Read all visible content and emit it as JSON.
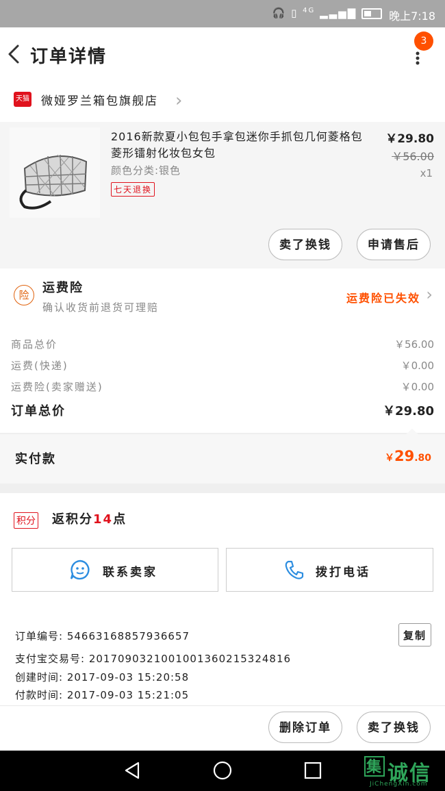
{
  "status_bar": {
    "signal_text": "4G",
    "time": "晚上7:18"
  },
  "header": {
    "title": "订单详情",
    "notification_count": "3"
  },
  "store": {
    "badge": "天猫",
    "name": "微娅罗兰箱包旗舰店"
  },
  "product": {
    "title": "2016新款夏小包包手拿包迷你手抓包几何菱格包菱形镭射化妆包女包",
    "attribute": "颜色分类:银色",
    "tag": "七天退换",
    "price": "￥29.80",
    "original_price": "￥56.00",
    "quantity": "x1",
    "buttons": {
      "sell_for_cash": "卖了换钱",
      "after_sales": "申请售后"
    }
  },
  "shipping_insurance": {
    "icon_char": "险",
    "title": "运费险",
    "subtitle": "确认收货前退货可理赔",
    "status": "运费险已失效"
  },
  "summary": {
    "rows": [
      {
        "label": "商品总价",
        "value": "￥56.00"
      },
      {
        "label": "运费(快递)",
        "value": "￥0.00"
      },
      {
        "label": "运费险(卖家赠送)",
        "value": "￥0.00"
      }
    ],
    "order_total_label": "订单总价",
    "order_total_value": "￥29.80",
    "paid_label": "实付款",
    "paid_currency": "￥",
    "paid_integer": "29",
    "paid_decimal": ".80"
  },
  "points": {
    "tag": "积分",
    "prefix": "返积分",
    "number": "14",
    "suffix": "点"
  },
  "contact": {
    "seller_label": "联系卖家",
    "call_label": "拨打电话"
  },
  "order_info": {
    "order_no": "订单编号: 54663168857936657",
    "alipay_no": "支付宝交易号: 2017090321001001360215324816",
    "created": "创建时间: 2017-09-03 15:20:58",
    "paid_time": "付款时间: 2017-09-03 15:21:05",
    "copy_label": "复制"
  },
  "bottom_actions": {
    "delete_label": "删除订单",
    "sell_label": "卖了换钱"
  },
  "watermark": {
    "box_char": "集",
    "text": "诚信",
    "sub": "JiChengXin.com"
  }
}
